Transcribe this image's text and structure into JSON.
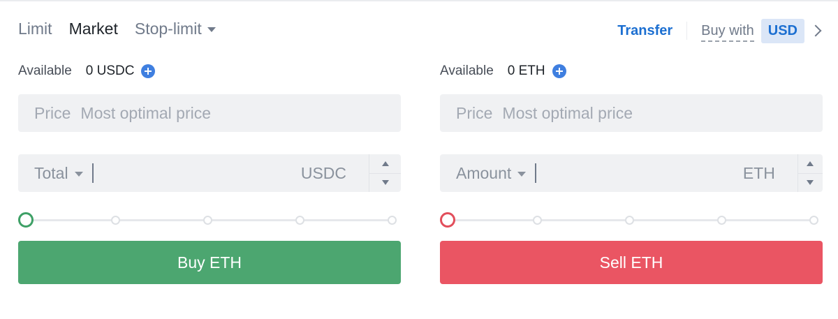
{
  "tabs": [
    {
      "label": "Limit",
      "active": false
    },
    {
      "label": "Market",
      "active": true
    },
    {
      "label": "Stop-limit",
      "active": false,
      "dropdown": true
    }
  ],
  "header": {
    "transfer": "Transfer",
    "buy_with": "Buy with",
    "currency": "USD"
  },
  "buy": {
    "available_label": "Available",
    "available_value": "0 USDC",
    "price_label": "Price",
    "price_placeholder": "Most optimal price",
    "amount_mode": "Total",
    "unit": "USDC",
    "slider_percent": 0,
    "button": "Buy ETH",
    "color": "#4ca670"
  },
  "sell": {
    "available_label": "Available",
    "available_value": "0 ETH",
    "price_label": "Price",
    "price_placeholder": "Most optimal price",
    "amount_mode": "Amount",
    "unit": "ETH",
    "slider_percent": 0,
    "button": "Sell ETH",
    "color": "#ea5563"
  },
  "icons": {
    "add_funds": "plus-circle-icon",
    "currency_next": "chevron-right-icon",
    "dropdown": "caret-down-icon"
  }
}
